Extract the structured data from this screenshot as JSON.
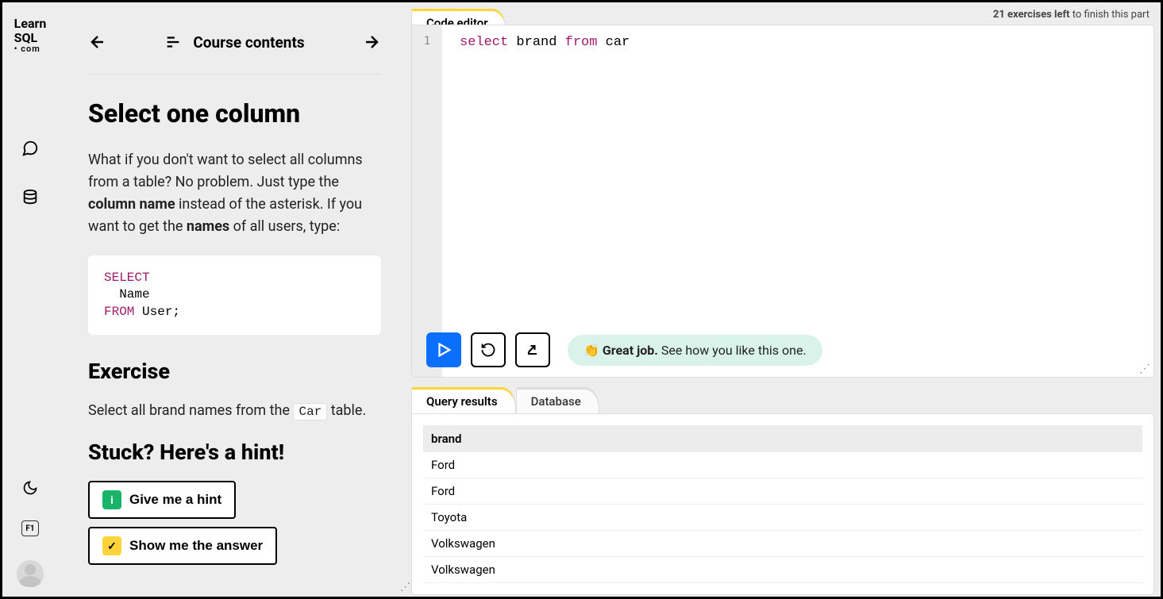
{
  "logo": {
    "l1": "Learn",
    "l2": "SQL",
    "l3": "• com"
  },
  "nav": {
    "title": "Course contents"
  },
  "lesson": {
    "title": "Select one column",
    "p1a": "What if you don't want to select all columns from a table? No problem. Just type the ",
    "p1b": "column name",
    "p1c": " instead of the asterisk. If you want to get the ",
    "p1d": "names",
    "p1e": " of all users, type:",
    "code_kw1": "SELECT",
    "code_ident": "  Name",
    "code_kw2": "FROM",
    "code_rest": " User;",
    "exercise_h": "Exercise",
    "exercise_a": "Select all brand names from the ",
    "exercise_code": "Car",
    "exercise_b": " table.",
    "hint_h": "Stuck? Here's a hint!",
    "hint_btn": "Give me a hint",
    "answer_btn": "Show me the answer"
  },
  "topbar": {
    "left_bold": "21 exercises left",
    "left_rest": " to finish this part"
  },
  "editor": {
    "tab": "Code editor",
    "line_no": "1",
    "kw1": "select",
    "ident1": " brand ",
    "kw2": "from",
    "ident2": " car"
  },
  "feedback": {
    "emoji": "👏",
    "bold": "Great job.",
    "rest": " See how you like this one."
  },
  "results": {
    "tab1": "Query results",
    "tab2": "Database",
    "header": "brand",
    "rows": [
      "Ford",
      "Ford",
      "Toyota",
      "Volkswagen",
      "Volkswagen"
    ]
  },
  "f1": "F1"
}
